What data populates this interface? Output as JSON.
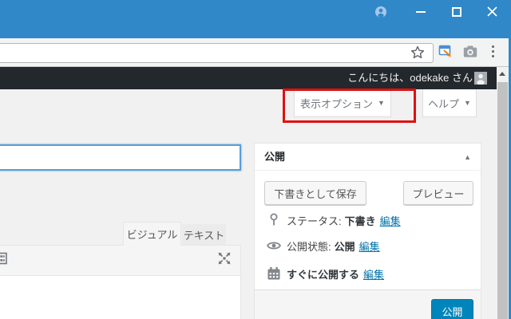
{
  "browser": {
    "titlebar": {
      "icons": [
        "profile-icon",
        "minimize-icon",
        "maximize-icon",
        "close-icon"
      ]
    },
    "toolbar": {
      "omnibox_value": "",
      "icons": [
        "bookmark-star-icon",
        "capture-page-extension-icon",
        "camera-extension-icon",
        "menu-dots-icon"
      ]
    }
  },
  "admin_bar": {
    "greeting": "こんにちは、odekake さん",
    "avatar": "user-avatar"
  },
  "screen_options": {
    "label": "表示オプション",
    "arrow": "▼"
  },
  "help": {
    "label": "ヘルプ",
    "arrow": "▼"
  },
  "annotation": {
    "purpose": "highlight-screen-options-button",
    "color": "#e01010"
  },
  "post_editor": {
    "title_value": "",
    "title_placeholder": "",
    "tabs": [
      {
        "label": "ビジュアル",
        "active": true
      },
      {
        "label": "テキスト",
        "active": false
      }
    ],
    "toolbar_icons": [
      "toolbar-toggle-icon",
      "fullscreen-icon"
    ]
  },
  "publish_panel": {
    "title": "公開",
    "toggle_arrow": "▲",
    "save_draft_label": "下書きとして保存",
    "preview_label": "プレビュー",
    "rows": [
      {
        "icon": "pin-icon",
        "label": "ステータス:",
        "value": "下書き",
        "action": "編集"
      },
      {
        "icon": "eye-icon",
        "label": "公開状態:",
        "value": "公開",
        "action": "編集"
      },
      {
        "icon": "calendar-icon",
        "label": "",
        "value": "すぐに公開する",
        "action": "編集"
      }
    ],
    "publish_label": "公開"
  },
  "colors": {
    "chrome_titlebar": "#3088c8",
    "admin_bar": "#23282d",
    "page_background": "#f1f1f1",
    "primary_button": "#0085ba",
    "link": "#0073aa",
    "annotation_red": "#e01010",
    "focused_input_border": "#5b9dd9"
  }
}
